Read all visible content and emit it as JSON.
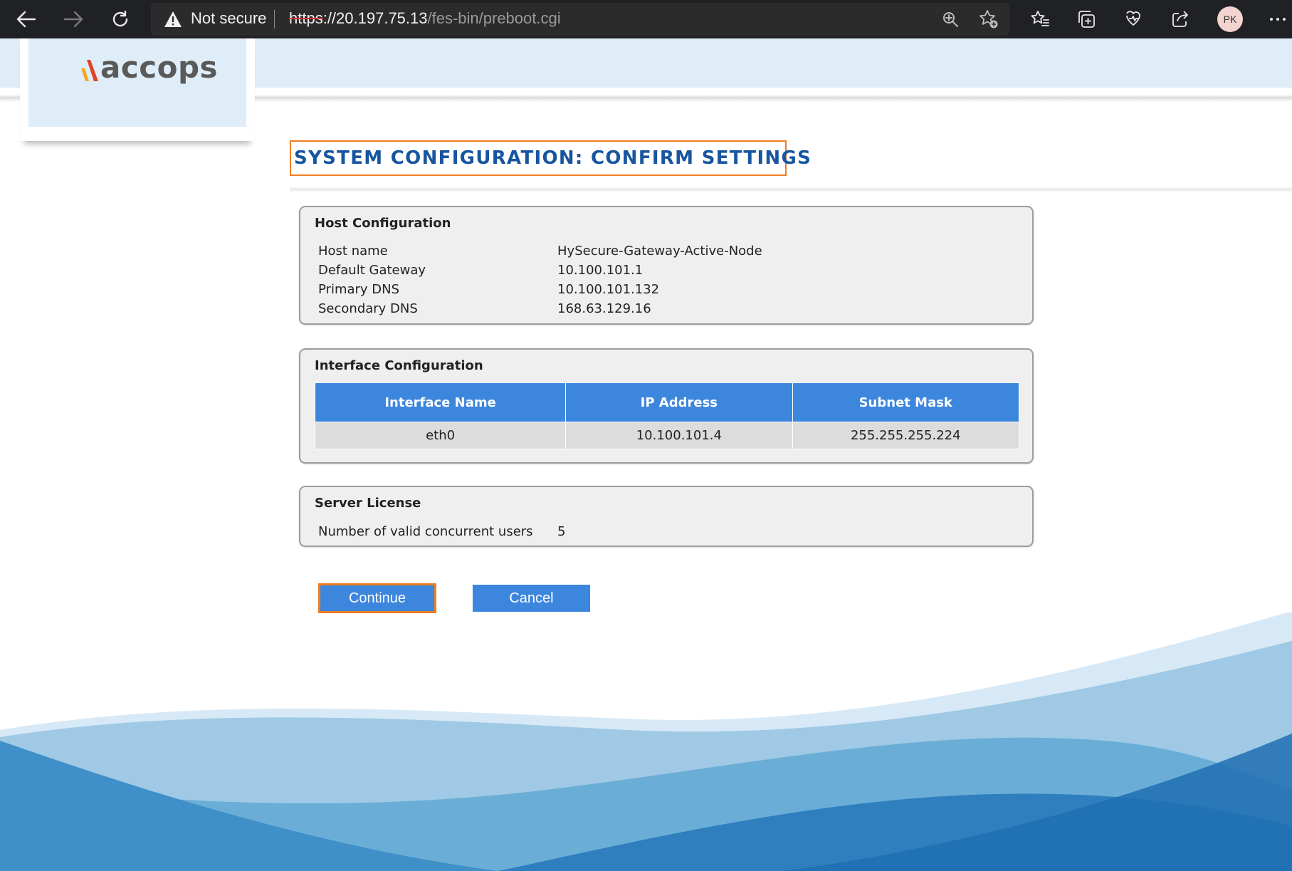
{
  "browser": {
    "security_label": "Not secure",
    "url_scheme": "https",
    "url_host": "://20.197.75.13",
    "url_path": "/fes-bin/preboot.cgi",
    "profile_initials": "PK"
  },
  "header": {
    "logo_text": "accops"
  },
  "page": {
    "title": "SYSTEM CONFIGURATION: CONFIRM SETTINGS"
  },
  "host_configuration": {
    "title": "Host Configuration",
    "rows": [
      {
        "label": "Host name",
        "value": "HySecure-Gateway-Active-Node"
      },
      {
        "label": "Default Gateway",
        "value": "10.100.101.1"
      },
      {
        "label": "Primary DNS",
        "value": "10.100.101.132"
      },
      {
        "label": "Secondary DNS",
        "value": "168.63.129.16"
      }
    ]
  },
  "interface_configuration": {
    "title": "Interface Configuration",
    "columns": [
      "Interface Name",
      "IP Address",
      "Subnet Mask"
    ],
    "rows": [
      [
        "eth0",
        "10.100.101.4",
        "255.255.255.224"
      ]
    ]
  },
  "server_license": {
    "title": "Server License",
    "label": "Number of valid concurrent users",
    "value": "5"
  },
  "actions": {
    "continue_label": "Continue",
    "cancel_label": "Cancel"
  },
  "colors": {
    "accent_blue": "#3d86dd",
    "title_blue": "#17559f",
    "highlight_orange": "#ef7d22",
    "header_band": "#deedf8"
  }
}
